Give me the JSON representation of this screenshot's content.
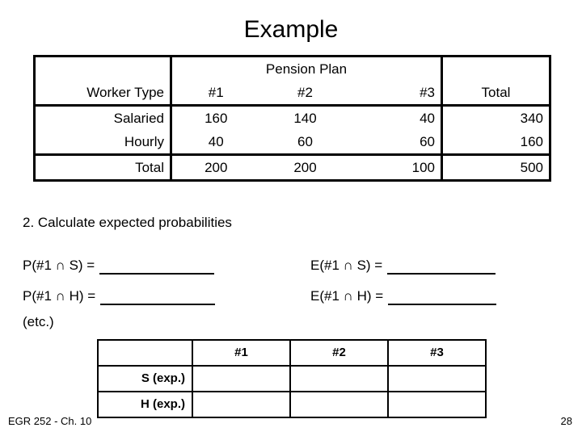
{
  "slide": {
    "title": "Example",
    "footer_left": "EGR 252 - Ch. 10",
    "page_number": "28"
  },
  "observed_table": {
    "group_header": "Pension Plan",
    "row_header_label": "Worker Type",
    "total_header": "Total",
    "plan_headers": [
      "#1",
      "#2",
      "#3"
    ],
    "rows": [
      {
        "label": "Salaried",
        "values": [
          "160",
          "140",
          "40"
        ],
        "total": "340"
      },
      {
        "label": "Hourly",
        "values": [
          "40",
          "60",
          "60"
        ],
        "total": "160"
      }
    ],
    "total_row": {
      "label": "Total",
      "values": [
        "200",
        "200",
        "100"
      ],
      "total": "500"
    }
  },
  "step": {
    "caption": "2. Calculate expected probabilities"
  },
  "blanks": {
    "rows": [
      {
        "left_label": "P(#1 ∩ S) =",
        "right_label": "E(#1 ∩ S) ="
      },
      {
        "left_label": "P(#1 ∩ H) =",
        "right_label": "E(#1 ∩ H) ="
      }
    ],
    "etc": "(etc.)"
  },
  "expected_table": {
    "corner": "",
    "headers": [
      "#1",
      "#2",
      "#3"
    ],
    "rows": [
      {
        "label": "S (exp.)",
        "cells": [
          "",
          "",
          ""
        ]
      },
      {
        "label": "H (exp.)",
        "cells": [
          "",
          "",
          ""
        ]
      }
    ]
  }
}
